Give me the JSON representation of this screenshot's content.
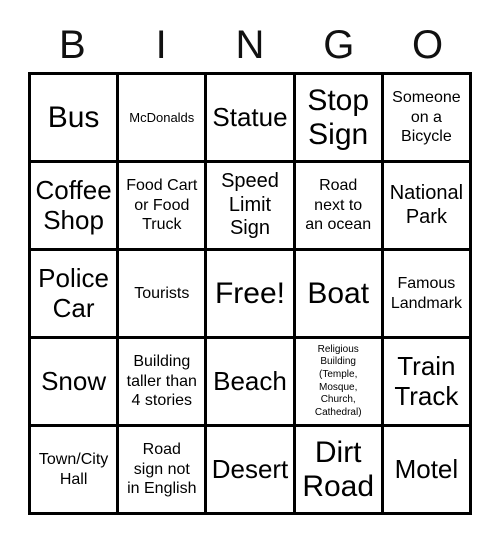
{
  "card": {
    "title": "BINGO",
    "header_letters": [
      "B",
      "I",
      "N",
      "G",
      "O"
    ],
    "colors": {
      "text": "#000000",
      "background": "#ffffff",
      "grid_line": "#000000"
    },
    "rows": [
      [
        {
          "text": "Bus",
          "size": "xl"
        },
        {
          "text": "McDonalds",
          "size": "xs"
        },
        {
          "text": "Statue",
          "size": "lg"
        },
        {
          "text": "Stop\nSign",
          "size": "xl"
        },
        {
          "text": "Someone\non a\nBicycle",
          "size": "sm"
        }
      ],
      [
        {
          "text": "Coffee\nShop",
          "size": "lg"
        },
        {
          "text": "Food Cart\nor Food\nTruck",
          "size": "sm"
        },
        {
          "text": "Speed\nLimit\nSign",
          "size": "md"
        },
        {
          "text": "Road\nnext to\nan ocean",
          "size": "sm"
        },
        {
          "text": "National\nPark",
          "size": "md"
        }
      ],
      [
        {
          "text": "Police\nCar",
          "size": "lg"
        },
        {
          "text": "Tourists",
          "size": "sm"
        },
        {
          "text": "Free!",
          "size": "xl"
        },
        {
          "text": "Boat",
          "size": "xl"
        },
        {
          "text": "Famous\nLandmark",
          "size": "sm"
        }
      ],
      [
        {
          "text": "Snow",
          "size": "lg"
        },
        {
          "text": "Building\ntaller than\n4 stories",
          "size": "sm"
        },
        {
          "text": "Beach",
          "size": "lg"
        },
        {
          "text": "Religious\nBuilding\n(Temple,\nMosque,\nChurch,\nCathedral)",
          "size": "xxs"
        },
        {
          "text": "Train\nTrack",
          "size": "lg"
        }
      ],
      [
        {
          "text": "Town/City\nHall",
          "size": "sm"
        },
        {
          "text": "Road\nsign not\nin English",
          "size": "sm"
        },
        {
          "text": "Desert",
          "size": "lg"
        },
        {
          "text": "Dirt\nRoad",
          "size": "xl"
        },
        {
          "text": "Motel",
          "size": "lg"
        }
      ]
    ]
  }
}
